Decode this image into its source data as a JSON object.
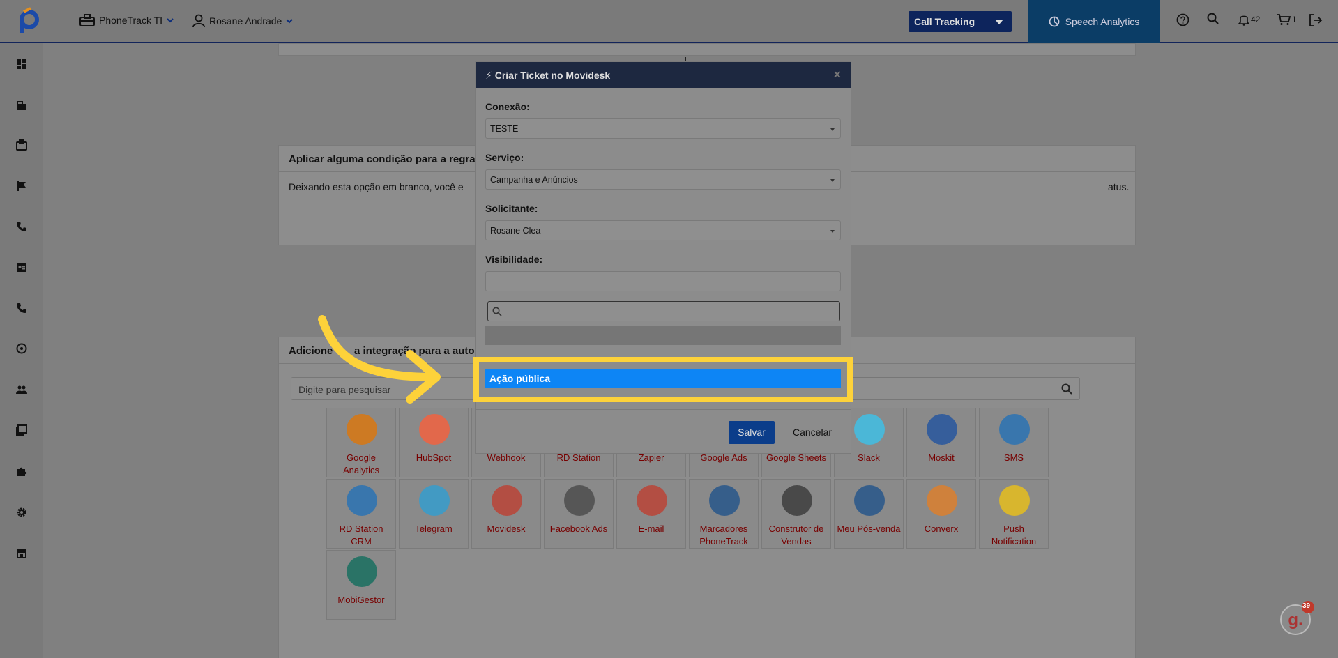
{
  "topbar": {
    "account_label": "PhoneTrack TI",
    "user_label": "Rosane Andrade",
    "product_select": "Call Tracking",
    "speech_label": "Speech Analytics",
    "notifications_count": "42",
    "cart_count": "1"
  },
  "page": {
    "condition_title": "Aplicar alguma condição para a regra",
    "condition_text": "Deixando esta opção em branco, você e",
    "condition_text_tail": "atus.",
    "integration_title_left": "Adicione",
    "integration_title_mid": "a integração para a auto",
    "search_placeholder": "Digite para pesquisar"
  },
  "integrations": [
    {
      "label": "Google Analytics",
      "color": "#e37400"
    },
    {
      "label": "HubSpot",
      "color": "#ff5c35"
    },
    {
      "label": "Webhook",
      "color": "#777777"
    },
    {
      "label": "RD Station",
      "color": "#777777"
    },
    {
      "label": "Zapier",
      "color": "#777777"
    },
    {
      "label": "Google Ads",
      "color": "#777777"
    },
    {
      "label": "Google Sheets",
      "color": "#777777"
    },
    {
      "label": "Slack",
      "color": "#36c5f0"
    },
    {
      "label": "Moskit",
      "color": "#1a4fa0"
    },
    {
      "label": "SMS",
      "color": "#1d6fb8"
    },
    {
      "label": "RD Station CRM",
      "color": "#1d6fb8"
    },
    {
      "label": "Telegram",
      "color": "#2a9fd6"
    },
    {
      "label": "Movidesk",
      "color": "#c0392b"
    },
    {
      "label": "Facebook Ads",
      "color": "#444444"
    },
    {
      "label": "E-mail",
      "color": "#c0392b"
    },
    {
      "label": "Marcadores PhoneTrack",
      "color": "#1a4f8a"
    },
    {
      "label": "Construtor de Vendas",
      "color": "#333333"
    },
    {
      "label": "Meu Pós-venda",
      "color": "#1a4f8a"
    },
    {
      "label": "Converx",
      "color": "#e67e22"
    },
    {
      "label": "Push Notification",
      "color": "#f1c40f"
    },
    {
      "label": "MobiGestor",
      "color": "#0a6b5a"
    }
  ],
  "modal": {
    "title": "Criar Ticket no Movidesk",
    "close": "×",
    "conexao_label": "Conexão:",
    "conexao_value": "TESTE",
    "servico_label": "Serviço:",
    "servico_value": "Campanha e Anúncios",
    "solicitante_label": "Solicitante:",
    "solicitante_value": "Rosane Clea",
    "visibilidade_label": "Visibilidade:",
    "dropdown_selected": "Ação pública",
    "save_label": "Salvar",
    "cancel_label": "Cancelar"
  },
  "badge": {
    "count": "39"
  },
  "colors": {
    "highlight_frame": "#fdd23a",
    "arrow": "#fdd23a",
    "selected_option": "#0d85f5"
  }
}
